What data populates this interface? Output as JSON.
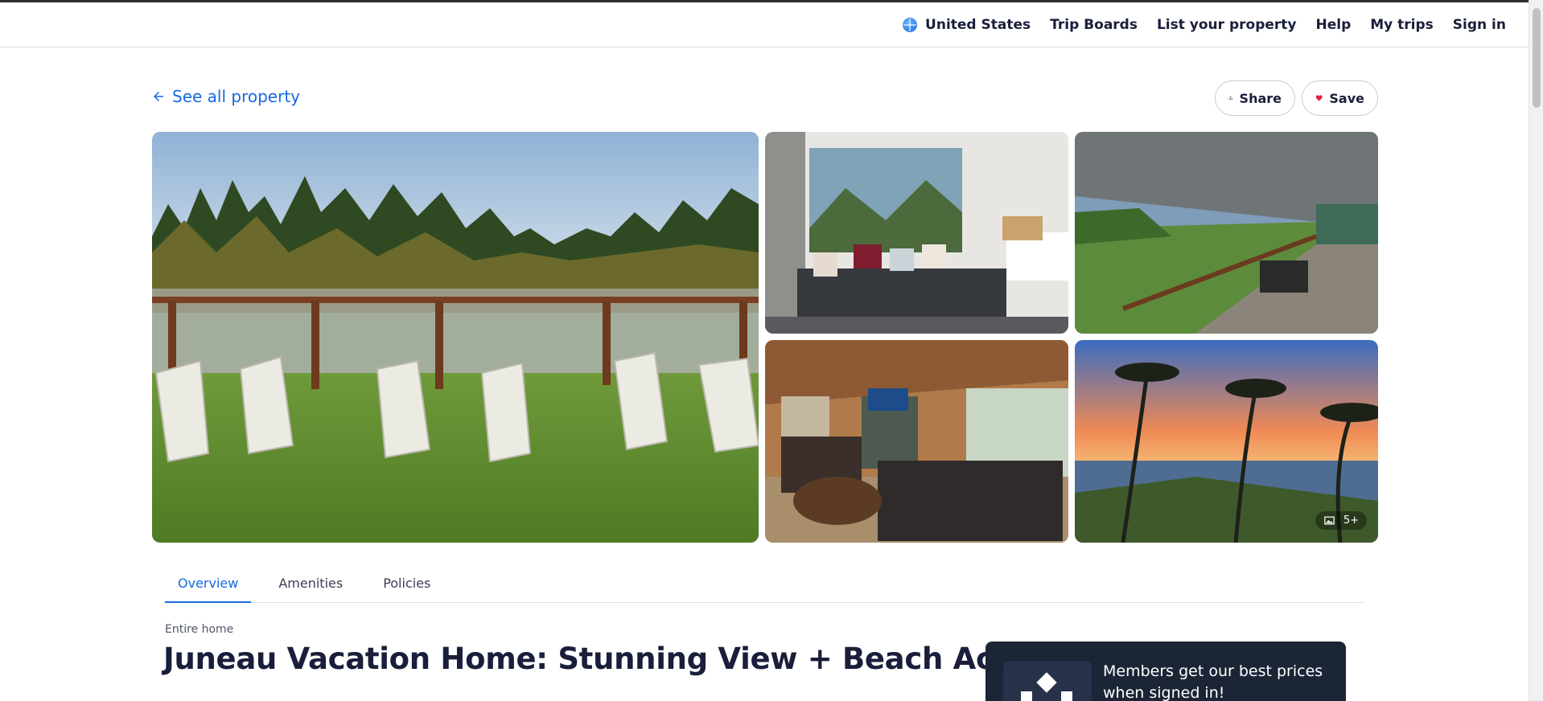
{
  "header": {
    "region": "United States",
    "nav": [
      "Trip Boards",
      "List your property",
      "Help",
      "My trips",
      "Sign in"
    ]
  },
  "back_link": "See all property",
  "actions": {
    "share": "Share",
    "save": "Save"
  },
  "gallery": {
    "photos": [
      "river-view-adirondack-chairs",
      "bedroom-with-sofa",
      "covered-deck",
      "living-room-fireplace",
      "sunset-palms"
    ],
    "more_count": "5+"
  },
  "tabs": [
    "Overview",
    "Amenities",
    "Policies"
  ],
  "property": {
    "type": "Entire home",
    "title": "Juneau Vacation Home: Stunning View + Beach Access"
  },
  "members_card": {
    "text": "Members get our best prices when signed in!"
  },
  "colors": {
    "link": "#1668e3",
    "save_heart": "#e41e3f",
    "card_bg": "#1c2536"
  }
}
